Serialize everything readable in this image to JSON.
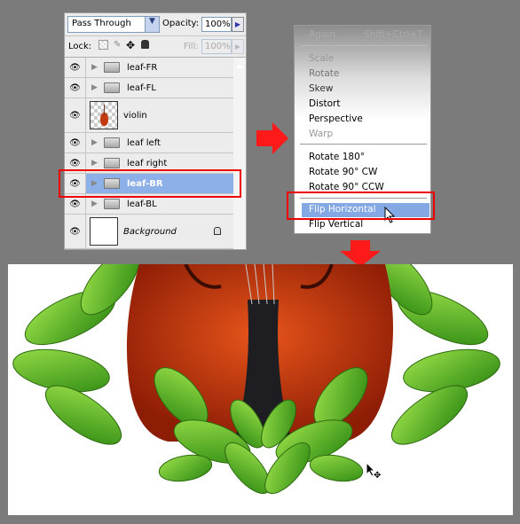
{
  "layers_panel": {
    "blend_mode": "Pass Through",
    "opacity_label": "Opacity:",
    "opacity_value": "100%",
    "lock_label": "Lock:",
    "fill_label": "Fill:",
    "fill_value": "100%",
    "layers": [
      {
        "name": "leaf-FR",
        "type": "group"
      },
      {
        "name": "leaf-FL",
        "type": "group"
      },
      {
        "name": "violin",
        "type": "layer"
      },
      {
        "name": "leaf left",
        "type": "group"
      },
      {
        "name": "leaf right",
        "type": "group"
      },
      {
        "name": "leaf-BR",
        "type": "group",
        "selected": true
      },
      {
        "name": "leaf-BL",
        "type": "group"
      },
      {
        "name": "Background",
        "type": "background",
        "locked": true
      }
    ]
  },
  "transform_menu": {
    "items": [
      {
        "label": "Again",
        "shortcut": "Shift+Ctrl+T",
        "disabled": true
      },
      {
        "label": "Scale"
      },
      {
        "label": "Rotate"
      },
      {
        "label": "Skew"
      },
      {
        "label": "Distort"
      },
      {
        "label": "Perspective"
      },
      {
        "label": "Warp",
        "disabled": true
      },
      {
        "label": "Rotate 180°"
      },
      {
        "label": "Rotate 90° CW"
      },
      {
        "label": "Rotate 90° CCW"
      },
      {
        "label": "Flip Horizontal",
        "highlighted": true
      },
      {
        "label": "Flip Vertical"
      }
    ]
  },
  "colors": {
    "highlight": "#e00000",
    "selection": "#8db0e8",
    "arrow": "#ff1a1a"
  }
}
